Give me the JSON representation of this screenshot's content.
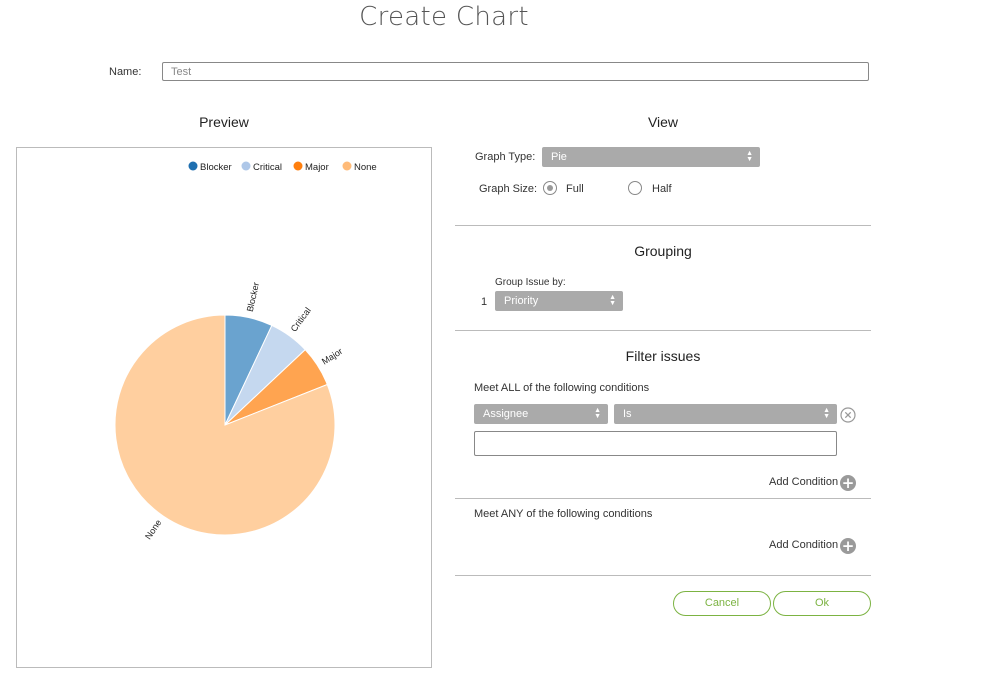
{
  "header": {
    "title": "Create Chart"
  },
  "name_field": {
    "label": "Name:",
    "value": "Test"
  },
  "preview": {
    "title": "Preview"
  },
  "view": {
    "title": "View",
    "graph_type_label": "Graph Type:",
    "graph_type_value": "Pie",
    "graph_size_label": "Graph Size:",
    "size_full_label": "Full",
    "size_half_label": "Half",
    "selected_size": "Full"
  },
  "grouping": {
    "title": "Grouping",
    "group_by_label": "Group Issue by:",
    "index": "1",
    "group_by_value": "Priority"
  },
  "filter": {
    "title": "Filter issues",
    "meet_all_label": "Meet ALL of the following conditions",
    "condition_field": "Assignee",
    "condition_operator": "Is",
    "condition_value": "",
    "add_condition_label": "Add Condition",
    "meet_any_label": "Meet ANY of the following conditions"
  },
  "actions": {
    "cancel_label": "Cancel",
    "ok_label": "Ok"
  },
  "chart_data": {
    "type": "pie",
    "title": "",
    "legend_position": "top-right",
    "slices": [
      {
        "label": "Blocker",
        "value": 7,
        "color": "#6aa3cf",
        "legend_color": "#1f6fb0"
      },
      {
        "label": "Critical",
        "value": 6,
        "color": "#c5d8ef",
        "legend_color": "#aec7e8"
      },
      {
        "label": "Major",
        "value": 6,
        "color": "#ffa450",
        "legend_color": "#ff7f0e"
      },
      {
        "label": "None",
        "value": 81,
        "color": "#ffcf9f",
        "legend_color": "#ffbb78"
      }
    ]
  }
}
